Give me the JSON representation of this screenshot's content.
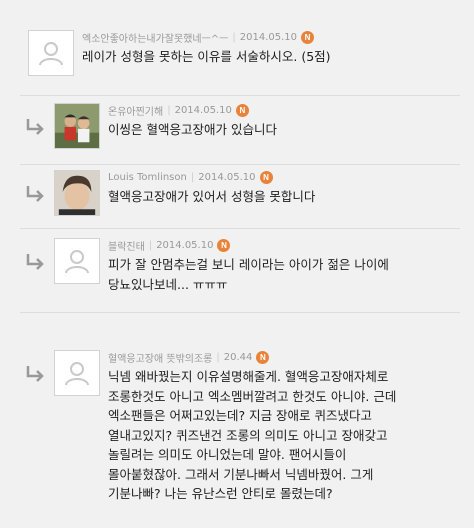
{
  "comments": [
    {
      "nickname": "엑소안좋아하는내가잘못했네ㅡ^ㅡ",
      "date": "2014.05.10",
      "badge": "N",
      "text": "레이가 성형을 못하는 이유를 서술하시오. (5점)",
      "avatar_icon": "default-user-icon"
    },
    {
      "nickname": "온유아찐기해",
      "date": "2014.05.10",
      "badge": "N",
      "text": "이씽은 혈액응고장애가 있습니다",
      "avatar_icon": "photo-avatar"
    },
    {
      "nickname": "Louis Tomlinson",
      "date": "2014.05.10",
      "badge": "N",
      "text": "혈액응고장애가 있어서 성형을 못합니다",
      "avatar_icon": "photo-avatar"
    },
    {
      "nickname": "블락진태",
      "date": "2014.05.10",
      "badge": "N",
      "text_lines": [
        "피가 잘 안멈추는걸 보니 레이라는 아이가 젊은 나이에",
        "당뇨있나보네... ㅠㅠㅠ"
      ],
      "avatar_icon": "default-user-icon"
    },
    {
      "nickname": "혈액응고장애 뜻밖의조롱",
      "date": "20.44",
      "badge": "N",
      "text_lines": [
        "닉넴 왜바꿨는지 이유설명해줄게. 혈액응고장애자체로",
        "조롱한것도 아니고 엑소멤버깔려고 한것도 아니야. 근데",
        "엑소팬들은 어쩌고있는데? 지금 장애로 퀴즈냈다고",
        "열내고있지? 퀴즈낸건 조롱의 의미도 아니고 장애갖고",
        "놀릴려는 의미도 아니었는데 말야. 팬어시들이",
        "몰아붙혔잖아. 그래서 기분나빠서 닉넴바꿨어. 그게",
        "기분나빠? 나는 유난스런 안티로 몰렸는데?"
      ],
      "avatar_icon": "default-user-icon"
    }
  ]
}
